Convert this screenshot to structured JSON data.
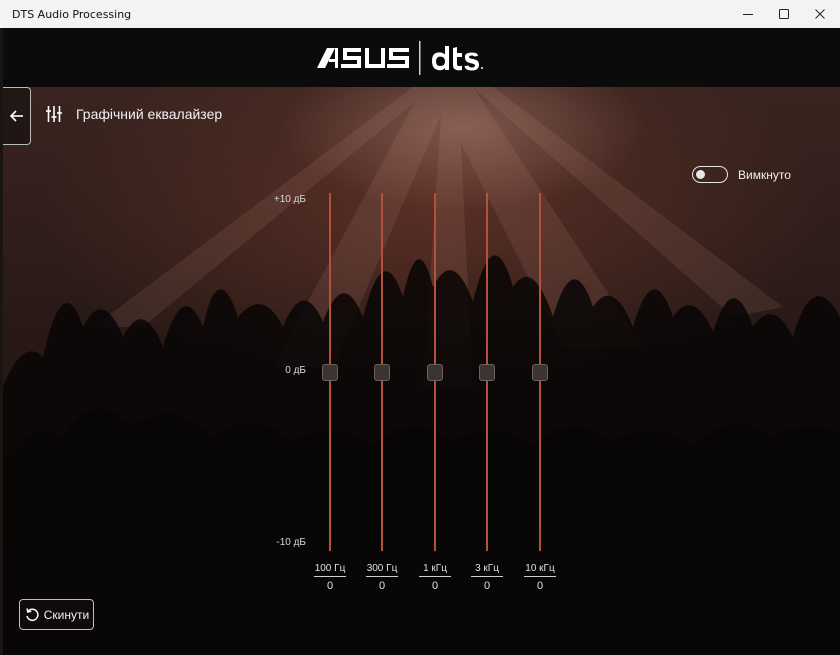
{
  "window": {
    "title": "DTS Audio Processing",
    "controls": [
      "minimize-icon",
      "maximize-icon",
      "close-icon"
    ]
  },
  "header": {
    "brand_left": "/ISUS",
    "brand_right": "dts"
  },
  "page": {
    "title": "Графічний еквалайзер",
    "back_icon": "arrow-left-icon",
    "title_icon": "equalizer-sliders-icon"
  },
  "toggle": {
    "state": false,
    "label": "Вимкнуто"
  },
  "scale": {
    "top": "+10 дБ",
    "mid": "0 дБ",
    "bottom": "-10 дБ"
  },
  "bands": [
    {
      "freq": "100 Гц",
      "value": "0",
      "gain": 0
    },
    {
      "freq": "300 Гц",
      "value": "0",
      "gain": 0
    },
    {
      "freq": "1 кГц",
      "value": "0",
      "gain": 0
    },
    {
      "freq": "3 кГц",
      "value": "0",
      "gain": 0
    },
    {
      "freq": "10 кГц",
      "value": "0",
      "gain": 0
    }
  ],
  "reset": {
    "label": "Скинути",
    "icon": "reset-icon"
  },
  "colors": {
    "track": "#b5503a",
    "header_bg": "#0b0b0b",
    "titlebar_bg": "#f3f3f3"
  }
}
